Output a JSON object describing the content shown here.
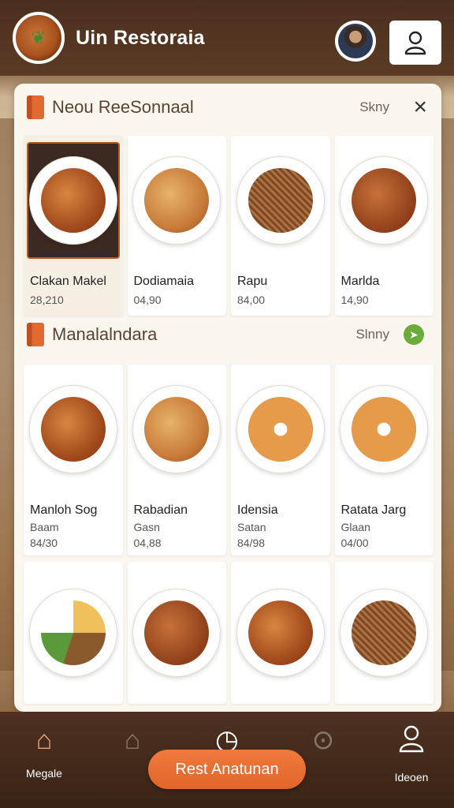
{
  "header": {
    "title": "Uin Restoraia",
    "logo_icon": "food-plate-icon",
    "profile_icon": "user-icon"
  },
  "colors": {
    "brand_brown": "#5b3b26",
    "accent_orange": "#e2652a",
    "go_green": "#6bab3a"
  },
  "menu": {
    "section1": {
      "title": "Neou ReeSonnaal",
      "side_label": "Skny",
      "close_label": "×",
      "items": [
        {
          "name": "Clakan Makel",
          "price": "28,210"
        },
        {
          "name": "Dodiamaia",
          "price": "04,90"
        },
        {
          "name": "Rapu",
          "price": "84,00"
        },
        {
          "name": "Marlda",
          "price": "14,90"
        }
      ]
    },
    "section2": {
      "title": "Manalalndara",
      "side_label": "Slnny",
      "go_label": "➤",
      "items": [
        {
          "name": "Manloh Sog",
          "sub": "Baam",
          "price": "84/30"
        },
        {
          "name": "Rabadian",
          "sub": "Gasn",
          "price": "04,88"
        },
        {
          "name": "Idensia",
          "sub": "Satan",
          "price": "84/98"
        },
        {
          "name": "Ratata Jarg",
          "sub": "Glaan",
          "price": "04/00"
        }
      ]
    }
  },
  "bottom_nav": {
    "items": [
      {
        "label": "Megale",
        "icon": "home-icon"
      },
      {
        "label": "",
        "icon": "house-icon"
      },
      {
        "label": "",
        "icon": "clock-icon"
      },
      {
        "label": "",
        "icon": "search-icon"
      },
      {
        "label": "Ideoen",
        "icon": "person-icon"
      }
    ],
    "cta_label": "Rest Anatunan"
  }
}
